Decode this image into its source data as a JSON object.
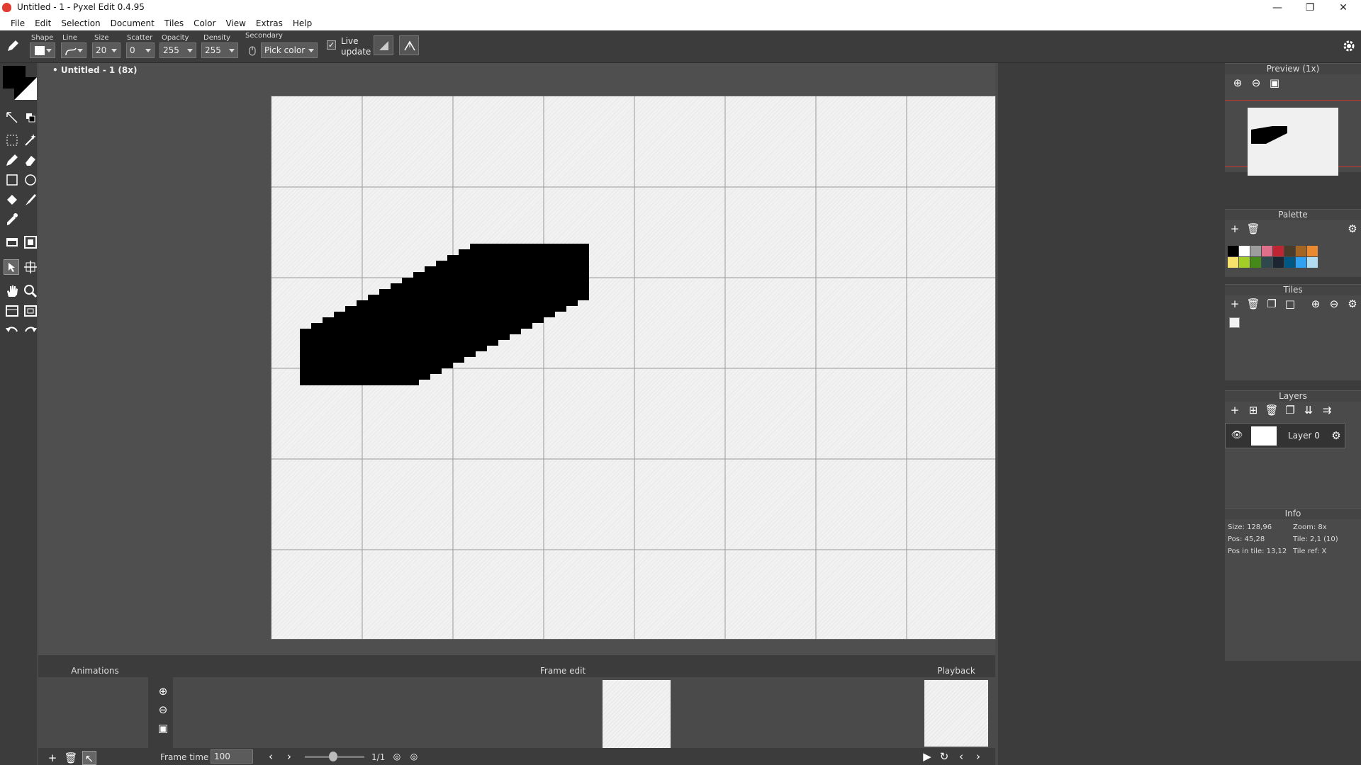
{
  "window": {
    "title": "Untitled - 1 - Pyxel Edit 0.4.95",
    "minimize": "—",
    "maximize": "❐",
    "close": "✕"
  },
  "menu": [
    "File",
    "Edit",
    "Selection",
    "Document",
    "Tiles",
    "Color",
    "View",
    "Extras",
    "Help"
  ],
  "toolbar": {
    "shape_label": "Shape",
    "line_label": "Line",
    "size_label": "Size",
    "size_value": "20",
    "scatter_label": "Scatter",
    "scatter_value": "0",
    "opacity_label": "Opacity",
    "opacity_value": "255",
    "density_label": "Density",
    "density_value": "255",
    "secondary_label": "Secondary",
    "secondary_value": "Pick color",
    "live_update_label_1": "Live",
    "live_update_label_2": "update",
    "live_update_checked": true
  },
  "document": {
    "tab_title": "• Untitled - 1   (8x)"
  },
  "preview_panel": {
    "title": "Preview (1x)"
  },
  "palette_panel": {
    "title": "Palette",
    "colors_row1": [
      "#000000",
      "#ffffff",
      "#9d9d9d",
      "#e06f8b",
      "#be2633",
      "#493c2b",
      "#a46422",
      "#eb8931"
    ],
    "colors_row2": [
      "#f7e26b",
      "#a3ce27",
      "#44891a",
      "#2f484e",
      "#1b2632",
      "#005784",
      "#31a2f2",
      "#b2dcef"
    ]
  },
  "tiles_panel": {
    "title": "Tiles"
  },
  "layers_panel": {
    "title": "Layers",
    "layers": [
      {
        "name": "Layer 0"
      }
    ]
  },
  "info_panel": {
    "title": "Info",
    "size": "Size: 128,96",
    "zoom": "Zoom: 8x",
    "pos": "Pos: 45,28",
    "tile": "Tile: 2,1 (10)",
    "pos_in_tile": "Pos in tile: 13,12",
    "tile_ref": "Tile ref: X"
  },
  "animations_panel": {
    "title": "Animations"
  },
  "frame_edit_panel": {
    "title": "Frame edit",
    "frame_time_label": "Frame time",
    "frame_time_value": "100",
    "frame_counter": "1/1"
  },
  "playback_panel": {
    "title": "Playback"
  }
}
